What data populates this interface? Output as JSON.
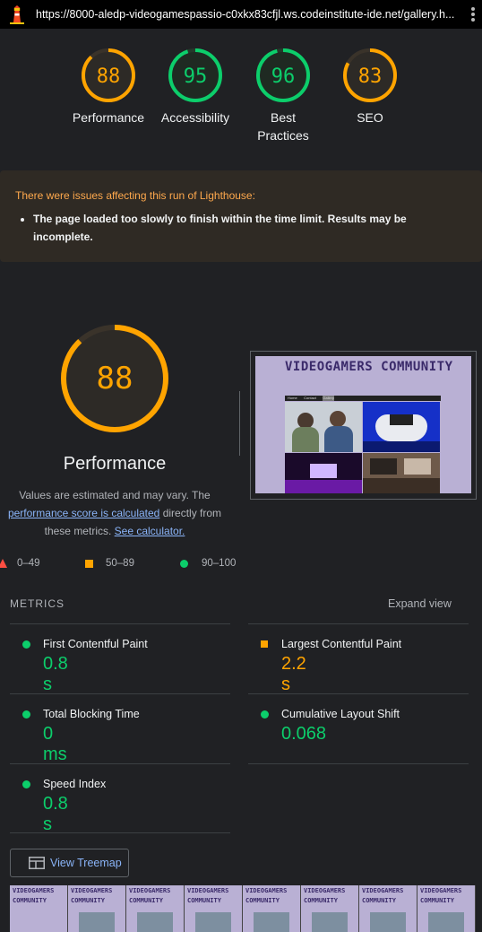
{
  "browser": {
    "url": "https://8000-aledp-videogamespassio-c0xkx83cfjl.ws.codeinstitute-ide.net/gallery.h..."
  },
  "summary": [
    {
      "score": "88",
      "label": "Performance",
      "color": "#ffa400"
    },
    {
      "score": "95",
      "label": "Accessibility",
      "color": "#0cce6b"
    },
    {
      "score": "96",
      "label": "Best Practices",
      "color": "#0cce6b"
    },
    {
      "score": "83",
      "label": "SEO",
      "color": "#ffa400"
    }
  ],
  "warning": {
    "title": "There were issues affecting this run of Lighthouse:",
    "item": "The page loaded too slowly to finish within the time limit. Results may be incomplete."
  },
  "performance": {
    "score": "88",
    "score_fraction": 0.88,
    "title": "Performance",
    "desc_pre": "Values are estimated and may vary. The ",
    "desc_link": "performance score is calculated",
    "desc_mid": " directly from these metrics. ",
    "desc_link2": "See calculator."
  },
  "legend": {
    "fail": "0–49",
    "average": "50–89",
    "pass": "90–100"
  },
  "screenshot": {
    "site_title": "VIDEOGAMERS COMMUNITY",
    "nav": [
      "Home",
      "Contact",
      "Gallery"
    ]
  },
  "metrics": {
    "header": "METRICS",
    "expand": "Expand view",
    "items": [
      {
        "name": "First Contentful Paint",
        "value": "0.8 s",
        "status": "pass"
      },
      {
        "name": "Largest Contentful Paint",
        "value": "2.2 s",
        "status": "average"
      },
      {
        "name": "Total Blocking Time",
        "value": "0 ms",
        "status": "pass"
      },
      {
        "name": "Cumulative Layout Shift",
        "value": "0.068",
        "status": "pass"
      },
      {
        "name": "Speed Index",
        "value": "0.8 s",
        "status": "pass"
      }
    ]
  },
  "treemap": {
    "label": "View Treemap"
  },
  "filmstrip": {
    "frame_text": "VIDEOGAMERS COMMUNITY"
  },
  "colors": {
    "pass": "#0cce6b",
    "average": "#ffa400",
    "fail": "#ff4e42",
    "link": "#8ab4f8"
  }
}
